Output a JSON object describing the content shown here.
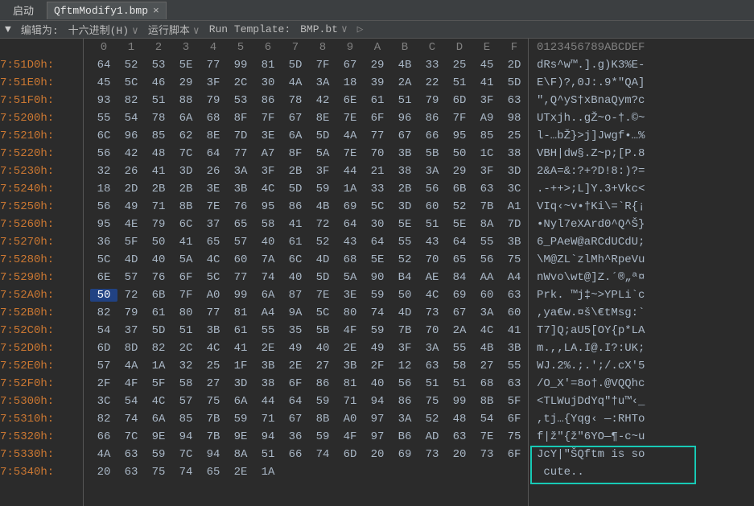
{
  "tab_bar": {
    "start_label": "启动",
    "tab_name": "QftmModify1.bmp",
    "close_glyph": "×"
  },
  "toolbar": {
    "tri": "▼",
    "edit_as_label": "编辑为:",
    "edit_as_value": "十六进制(H)",
    "run_script_label": "运行脚本",
    "run_template_label": "Run Template:",
    "run_template_value": "BMP.bt",
    "chev": "∨",
    "play": "▷"
  },
  "header": {
    "hex_cols": [
      "0",
      "1",
      "2",
      "3",
      "4",
      "5",
      "6",
      "7",
      "8",
      "9",
      "A",
      "B",
      "C",
      "D",
      "E",
      "F"
    ],
    "ascii_header": "0123456789ABCDEF"
  },
  "rows": [
    {
      "addr": "7:51D0h:",
      "hex": [
        "64",
        "52",
        "53",
        "5E",
        "77",
        "99",
        "81",
        "5D",
        "7F",
        "67",
        "29",
        "4B",
        "33",
        "25",
        "45",
        "2D"
      ],
      "ascii": "dRs^w™.].g)K3%E-"
    },
    {
      "addr": "7:51E0h:",
      "hex": [
        "45",
        "5C",
        "46",
        "29",
        "3F",
        "2C",
        "30",
        "4A",
        "3A",
        "18",
        "39",
        "2A",
        "22",
        "51",
        "41",
        "5D"
      ],
      "ascii": "E\\F)?,0J:.9*\"QA]"
    },
    {
      "addr": "7:51F0h:",
      "hex": [
        "93",
        "82",
        "51",
        "88",
        "79",
        "53",
        "86",
        "78",
        "42",
        "6E",
        "61",
        "51",
        "79",
        "6D",
        "3F",
        "63"
      ],
      "ascii": "\",Q^yS†xBnaQym?c"
    },
    {
      "addr": "7:5200h:",
      "hex": [
        "55",
        "54",
        "78",
        "6A",
        "68",
        "8F",
        "7F",
        "67",
        "8E",
        "7E",
        "6F",
        "96",
        "86",
        "7F",
        "A9",
        "98"
      ],
      "ascii": "UTxjh..gŽ~o-†.©~"
    },
    {
      "addr": "7:5210h:",
      "hex": [
        "6C",
        "96",
        "85",
        "62",
        "8E",
        "7D",
        "3E",
        "6A",
        "5D",
        "4A",
        "77",
        "67",
        "66",
        "95",
        "85",
        "25"
      ],
      "ascii": "l-…bŽ}>j]Jwgf•…%"
    },
    {
      "addr": "7:5220h:",
      "hex": [
        "56",
        "42",
        "48",
        "7C",
        "64",
        "77",
        "A7",
        "8F",
        "5A",
        "7E",
        "70",
        "3B",
        "5B",
        "50",
        "1C",
        "38"
      ],
      "ascii": "VBH|dw§.Z~p;[P.8"
    },
    {
      "addr": "7:5230h:",
      "hex": [
        "32",
        "26",
        "41",
        "3D",
        "26",
        "3A",
        "3F",
        "2B",
        "3F",
        "44",
        "21",
        "38",
        "3A",
        "29",
        "3F",
        "3D"
      ],
      "ascii": "2&A=&:?+?D!8:)?="
    },
    {
      "addr": "7:5240h:",
      "hex": [
        "18",
        "2D",
        "2B",
        "2B",
        "3E",
        "3B",
        "4C",
        "5D",
        "59",
        "1A",
        "33",
        "2B",
        "56",
        "6B",
        "63",
        "3C"
      ],
      "ascii": ".-++>;L]Y.3+Vkc<"
    },
    {
      "addr": "7:5250h:",
      "hex": [
        "56",
        "49",
        "71",
        "8B",
        "7E",
        "76",
        "95",
        "86",
        "4B",
        "69",
        "5C",
        "3D",
        "60",
        "52",
        "7B",
        "A1"
      ],
      "ascii": "VIq‹~v•†Ki\\=`R{¡"
    },
    {
      "addr": "7:5260h:",
      "hex": [
        "95",
        "4E",
        "79",
        "6C",
        "37",
        "65",
        "58",
        "41",
        "72",
        "64",
        "30",
        "5E",
        "51",
        "5E",
        "8A",
        "7D"
      ],
      "ascii": "•Nyl7eXArd0^Q^Š}"
    },
    {
      "addr": "7:5270h:",
      "hex": [
        "36",
        "5F",
        "50",
        "41",
        "65",
        "57",
        "40",
        "61",
        "52",
        "43",
        "64",
        "55",
        "43",
        "64",
        "55",
        "3B"
      ],
      "ascii": "6_PAeW@aRCdUCdU;"
    },
    {
      "addr": "7:5280h:",
      "hex": [
        "5C",
        "4D",
        "40",
        "5A",
        "4C",
        "60",
        "7A",
        "6C",
        "4D",
        "68",
        "5E",
        "52",
        "70",
        "65",
        "56",
        "75"
      ],
      "ascii": "\\M@ZL`zlMh^RpeVu"
    },
    {
      "addr": "7:5290h:",
      "hex": [
        "6E",
        "57",
        "76",
        "6F",
        "5C",
        "77",
        "74",
        "40",
        "5D",
        "5A",
        "90",
        "B4",
        "AE",
        "84",
        "AA",
        "A4"
      ],
      "ascii": "nWvo\\wt@]Z.´®„ª¤"
    },
    {
      "addr": "7:52A0h:",
      "hex": [
        "50",
        "72",
        "6B",
        "7F",
        "A0",
        "99",
        "6A",
        "87",
        "7E",
        "3E",
        "59",
        "50",
        "4C",
        "69",
        "60",
        "63"
      ],
      "ascii": "Prk. ™j‡~>YPLi`c",
      "sel": 0
    },
    {
      "addr": "7:52B0h:",
      "hex": [
        "82",
        "79",
        "61",
        "80",
        "77",
        "81",
        "A4",
        "9A",
        "5C",
        "80",
        "74",
        "4D",
        "73",
        "67",
        "3A",
        "60"
      ],
      "ascii": ",ya€w.¤š\\€tMsg:`"
    },
    {
      "addr": "7:52C0h:",
      "hex": [
        "54",
        "37",
        "5D",
        "51",
        "3B",
        "61",
        "55",
        "35",
        "5B",
        "4F",
        "59",
        "7B",
        "70",
        "2A",
        "4C",
        "41"
      ],
      "ascii": "T7]Q;aU5[OY{p*LA"
    },
    {
      "addr": "7:52D0h:",
      "hex": [
        "6D",
        "8D",
        "82",
        "2C",
        "4C",
        "41",
        "2E",
        "49",
        "40",
        "2E",
        "49",
        "3F",
        "3A",
        "55",
        "4B",
        "3B"
      ],
      "ascii": "m.,,LA.I@.I?:UK;"
    },
    {
      "addr": "7:52E0h:",
      "hex": [
        "57",
        "4A",
        "1A",
        "32",
        "25",
        "1F",
        "3B",
        "2E",
        "27",
        "3B",
        "2F",
        "12",
        "63",
        "58",
        "27",
        "55"
      ],
      "ascii": "WJ.2%.;.';/.cX'5"
    },
    {
      "addr": "7:52F0h:",
      "hex": [
        "2F",
        "4F",
        "5F",
        "58",
        "27",
        "3D",
        "38",
        "6F",
        "86",
        "81",
        "40",
        "56",
        "51",
        "51",
        "68",
        "63"
      ],
      "ascii": "/O_X'=8o†.@VQQhc"
    },
    {
      "addr": "7:5300h:",
      "hex": [
        "3C",
        "54",
        "4C",
        "57",
        "75",
        "6A",
        "44",
        "64",
        "59",
        "71",
        "94",
        "86",
        "75",
        "99",
        "8B",
        "5F"
      ],
      "ascii": "<TLWujDdYq\"†u™‹_"
    },
    {
      "addr": "7:5310h:",
      "hex": [
        "82",
        "74",
        "6A",
        "85",
        "7B",
        "59",
        "71",
        "67",
        "8B",
        "A0",
        "97",
        "3A",
        "52",
        "48",
        "54",
        "6F"
      ],
      "ascii": ",tj…{Yqg‹ —:RHTo"
    },
    {
      "addr": "7:5320h:",
      "hex": [
        "66",
        "7C",
        "9E",
        "94",
        "7B",
        "9E",
        "94",
        "36",
        "59",
        "4F",
        "97",
        "B6",
        "AD",
        "63",
        "7E",
        "75"
      ],
      "ascii": "f|ž\"{ž\"6YO—¶-c~u"
    },
    {
      "addr": "7:5330h:",
      "hex": [
        "4A",
        "63",
        "59",
        "7C",
        "94",
        "8A",
        "51",
        "66",
        "74",
        "6D",
        "20",
        "69",
        "73",
        "20",
        "73",
        "6F"
      ],
      "ascii": "JcY|\"ŠQftm is so"
    },
    {
      "addr": "7:5340h:",
      "hex": [
        "20",
        "63",
        "75",
        "74",
        "65",
        "2E",
        "1A",
        "",
        "",
        "",
        "",
        "",
        "",
        "",
        "",
        ""
      ],
      "ascii": " cute.."
    }
  ],
  "chart_data": null
}
